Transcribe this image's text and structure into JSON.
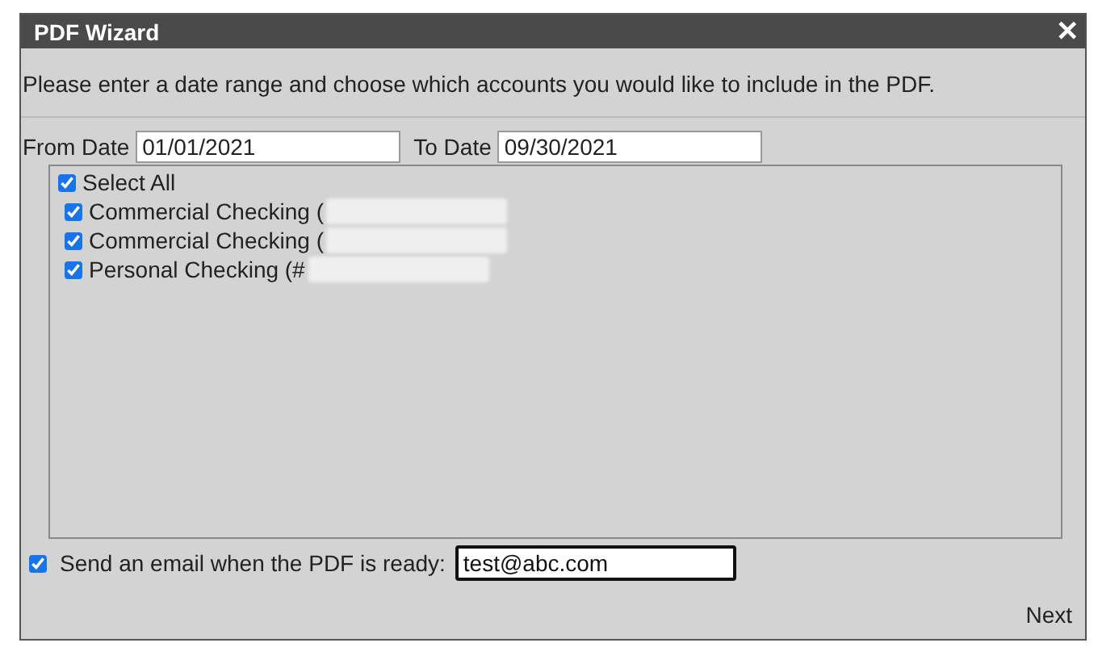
{
  "window": {
    "title": "PDF Wizard",
    "close": "✕"
  },
  "instructions": "Please enter a date range and choose which accounts you would like to include in the PDF.",
  "from_date": {
    "label": "From Date",
    "value": "01/01/2021"
  },
  "to_date": {
    "label": "To Date",
    "value": "09/30/2021"
  },
  "select_all": {
    "label": "Select All",
    "checked": true
  },
  "accounts": [
    {
      "label": "Commercial Checking (",
      "checked": true
    },
    {
      "label": "Commercial Checking (",
      "checked": true
    },
    {
      "label": "Personal Checking (#",
      "checked": true
    }
  ],
  "email": {
    "label": "Send an email when the PDF is ready:",
    "checked": true,
    "value": "test@abc.com"
  },
  "next": "Next"
}
